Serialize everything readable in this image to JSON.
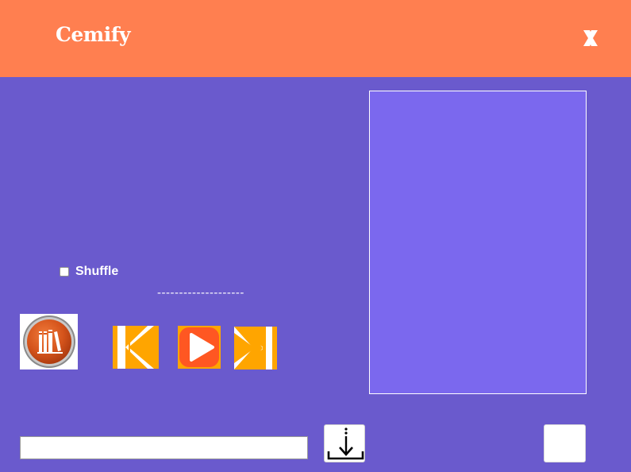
{
  "app": {
    "title": "Cemify"
  },
  "header": {
    "close_icon": "close-icon"
  },
  "player": {
    "shuffle_label": "Shuffle",
    "shuffle_checked": false,
    "now_playing_text": "--------------------"
  },
  "controls": {
    "library_icon": "library-books-icon",
    "prev_icon": "previous-track-icon",
    "play_icon": "play-icon",
    "next_icon": "next-track-icon"
  },
  "download": {
    "url_value": "",
    "download_icon": "download-icon"
  },
  "colors": {
    "header": "#ff7f50",
    "background": "#6a5acd",
    "panel": "#7b68ee",
    "control_accent": "#ffa500",
    "play_accent": "#ff5722"
  }
}
